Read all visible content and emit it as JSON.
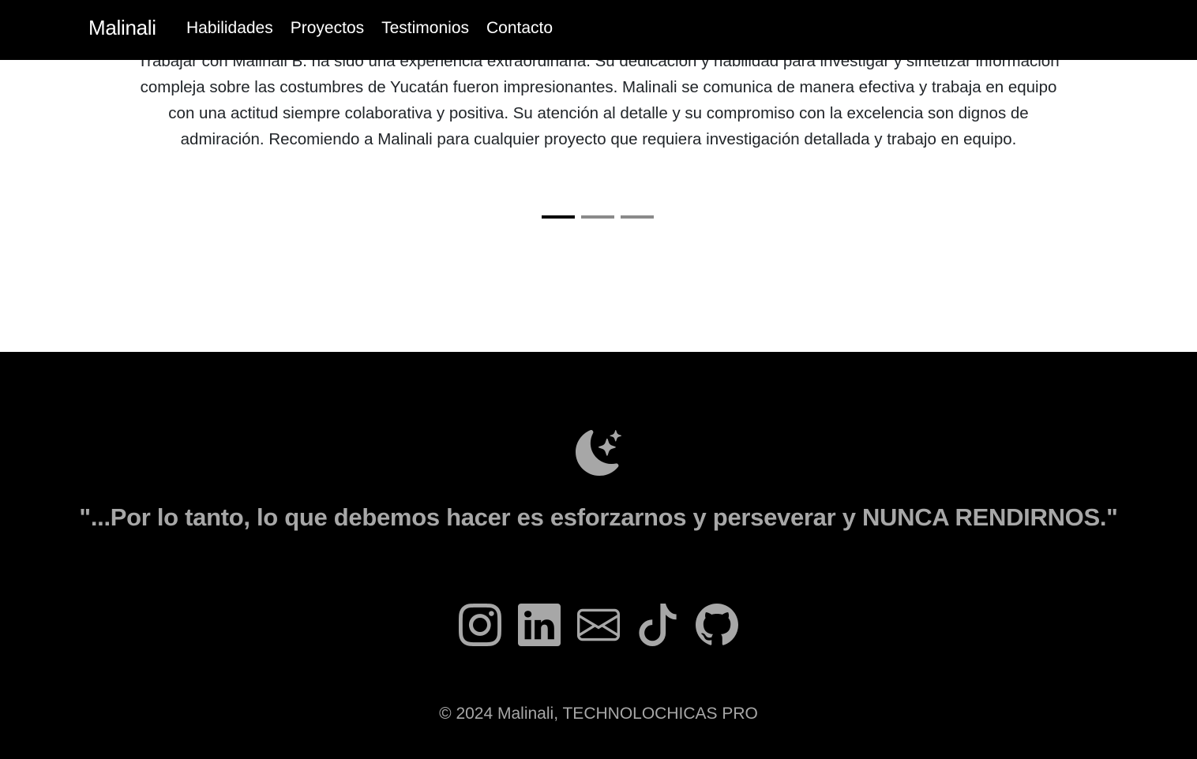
{
  "navbar": {
    "brand": "Malinali",
    "links": [
      "Habilidades",
      "Proyectos",
      "Testimonios",
      "Contacto"
    ]
  },
  "testimonial": {
    "text": "Trabajar con Malinali B. ha sido una experiencia extraordinaria. Su dedicación y habilidad para investigar y sintetizar información compleja sobre las costumbres de Yucatán fueron impresionantes. Malinali se comunica de manera efectiva y trabaja en equipo con una actitud siempre colaborativa y positiva. Su atención al detalle y su compromiso con la excelencia son dignos de admiración. Recomiendo a Malinali para cualquier proyecto que requiera investigación detallada y trabajo en equipo.",
    "indicators": [
      {
        "name": "carousel-indicator-1",
        "active": true
      },
      {
        "name": "carousel-indicator-2",
        "active": false
      },
      {
        "name": "carousel-indicator-3",
        "active": false
      }
    ]
  },
  "footer": {
    "icon": "moon-stars-icon",
    "quote": "\"...Por lo tanto, lo que debemos hacer es esforzarnos y perseverar y NUNCA RENDIRNOS.\"",
    "social": [
      "instagram-icon",
      "linkedin-icon",
      "envelope-icon",
      "tiktok-icon",
      "github-icon"
    ],
    "copyright": "© 2024 Malinali, TECHNOLOCHICAS PRO"
  },
  "colors": {
    "navbar_bg": "#000000",
    "footer_bg": "#000000",
    "footer_text": "#a7a7a7",
    "body_text": "#212529",
    "indicator_active": "#000000",
    "indicator_inactive": "#8a8a8a"
  }
}
